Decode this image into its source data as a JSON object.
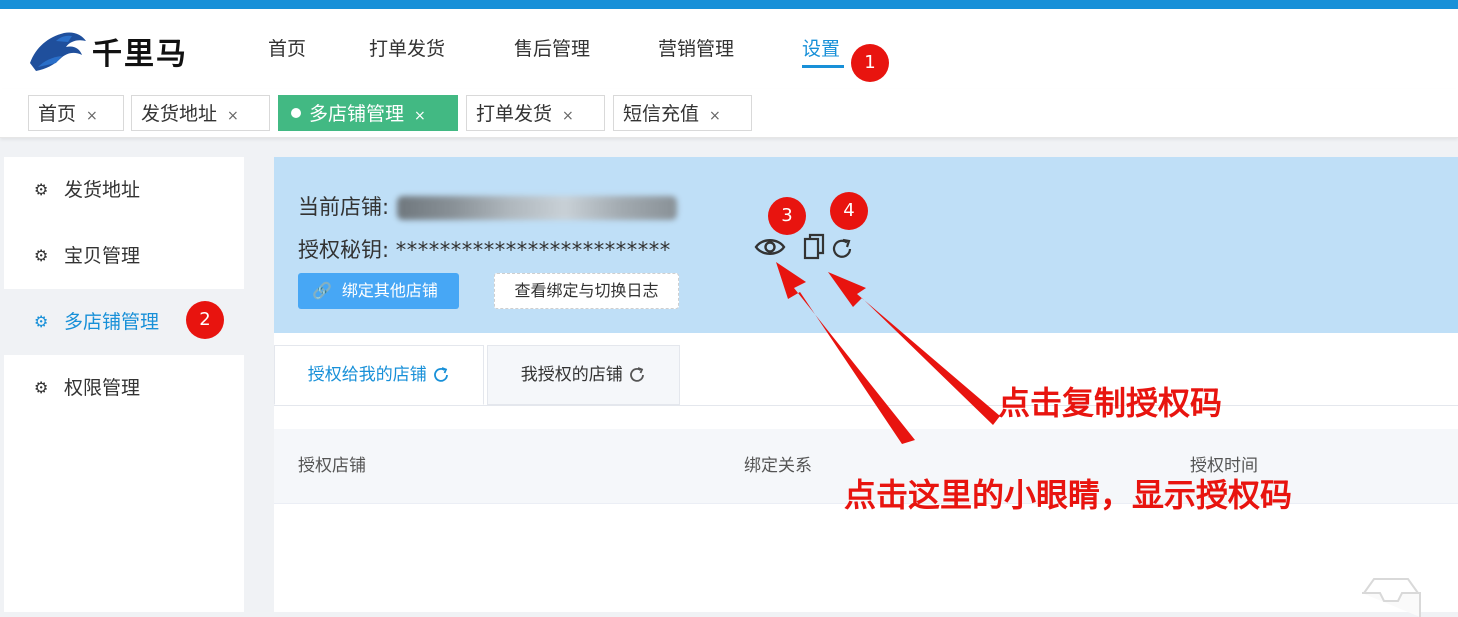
{
  "header": {
    "logo_text": "千里马",
    "nav": [
      "首页",
      "打单发货",
      "售后管理",
      "营销管理",
      "设置"
    ],
    "active_nav": "设置"
  },
  "tabs": [
    {
      "label": "首页"
    },
    {
      "label": "发货地址"
    },
    {
      "label": "多店铺管理",
      "active": true
    },
    {
      "label": "打单发货"
    },
    {
      "label": "短信充值"
    }
  ],
  "tab_close": "×",
  "sidebar": {
    "items": [
      {
        "label": "发货地址"
      },
      {
        "label": "宝贝管理"
      },
      {
        "label": "多店铺管理",
        "active": true
      },
      {
        "label": "权限管理"
      }
    ]
  },
  "info": {
    "current_store_label": "当前店铺:",
    "secret_label": "授权秘钥:",
    "secret_mask": "*************************",
    "bind_button": "绑定其他店铺",
    "log_button": "查看绑定与切换日志"
  },
  "subtabs": [
    {
      "label": "授权给我的店铺"
    },
    {
      "label": "我授权的店铺"
    }
  ],
  "table": {
    "headers": [
      "授权店铺",
      "绑定关系",
      "授权时间"
    ]
  },
  "annotations": {
    "badges": [
      "1",
      "2",
      "3",
      "4"
    ],
    "copy_note": "点击复制授权码",
    "eye_note": "点击这里的小眼睛，显示授权码"
  },
  "colors": {
    "accent": "#1890d8",
    "active_tag": "#42b983",
    "panel_bg": "#bfdff7",
    "annotation_red": "#e8140f"
  }
}
